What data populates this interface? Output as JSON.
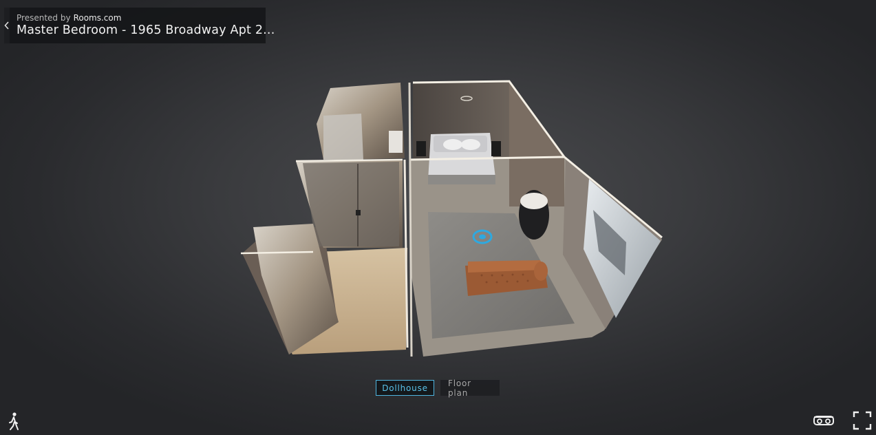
{
  "header": {
    "presented_by_label": "Presented by",
    "brand": "Rooms.com",
    "space_title": "Master Bedroom - 1965 Broadway Apt 2..."
  },
  "view_modes": [
    {
      "label": "Dollhouse",
      "active": true
    },
    {
      "label": "Floor plan",
      "active": false
    }
  ],
  "icons": {
    "back": "chevron-left-icon",
    "walk": "walk-person-icon",
    "vr": "vr-goggles-icon",
    "fullscreen": "fullscreen-icon"
  },
  "colors": {
    "accent": "#4fb6e0",
    "background": "#3a3b3e"
  }
}
